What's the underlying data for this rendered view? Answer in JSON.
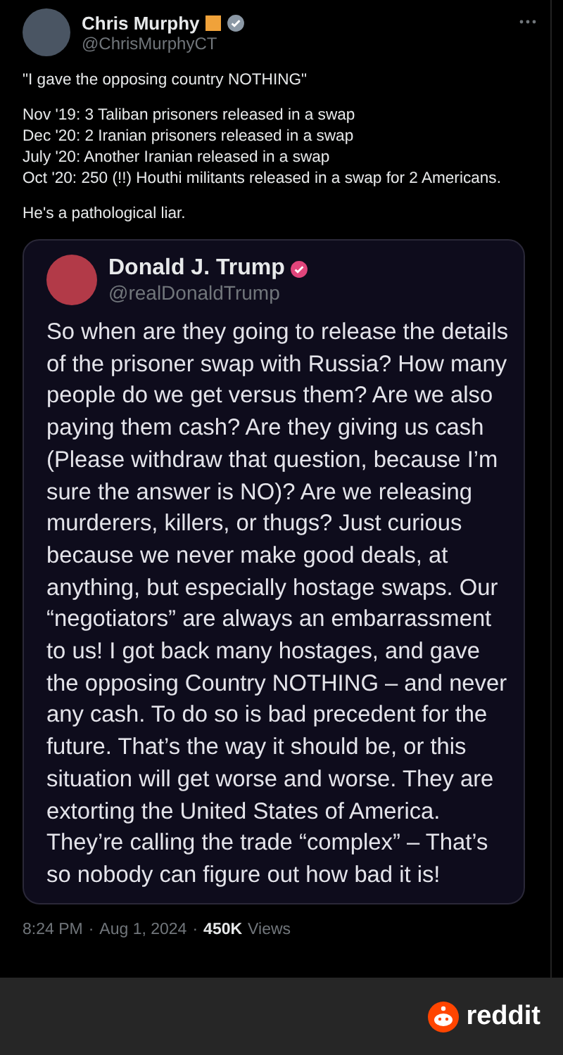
{
  "tweet": {
    "author": {
      "name": "Chris Murphy",
      "handle": "@ChrisMurphyCT",
      "affiliate_badge": true,
      "verified": true
    },
    "paragraphs": [
      "\"I gave the opposing country NOTHING\"",
      "Nov '19: 3 Taliban prisoners released in a swap\nDec '20: 2 Iranian prisoners released in a swap\nJuly '20: Another Iranian released in a swap\nOct '20: 250 (!!) Houthi militants released in a swap for 2 Americans.",
      "He's a pathological liar."
    ],
    "quote": {
      "author": {
        "name": "Donald J. Trump",
        "handle": "@realDonaldTrump",
        "verified": true
      },
      "text": "So when are they going to release the details of the prisoner swap with Russia? How many people do we get versus them? Are we also paying them cash? Are they giving us cash (Please withdraw that question, because I’m sure the answer is NO)? Are we releasing murderers, killers, or thugs? Just curious because we never make good deals, at anything, but especially hostage swaps. Our “negotiators” are always an embarrassment to us! I got back many hostages, and gave the opposing Country NOTHING – and never any cash. To do so is bad precedent for the future. That’s the way it should be, or this situation will get worse and worse. They are extorting the United States of America. They’re calling the trade “complex” – That’s so nobody can figure out how bad it is!"
    },
    "time": "8:24 PM",
    "date": "Aug 1, 2024",
    "views_count": "450K",
    "views_label": "Views",
    "separator": "·"
  },
  "footer": {
    "brand": "reddit"
  }
}
